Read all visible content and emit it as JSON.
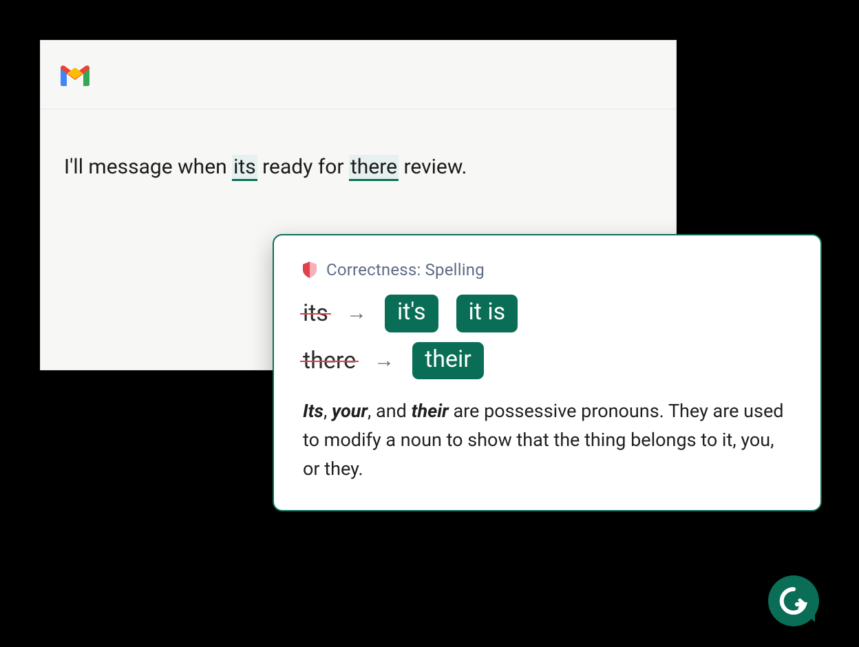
{
  "compose": {
    "sentence_parts": {
      "p0": "I'll message when ",
      "hl0": "its",
      "p1": " ready for ",
      "hl1": "there",
      "p2": " review."
    }
  },
  "card": {
    "category": "Correctness: Spelling",
    "rows": [
      {
        "original": "its",
        "suggestions": [
          "it's",
          "it is"
        ]
      },
      {
        "original": "there",
        "suggestions": [
          "their"
        ]
      }
    ],
    "explain": {
      "b0": "Its",
      "t0": ", ",
      "b1": "your",
      "t1": ", and ",
      "b2": "their",
      "t2": " are possessive pronouns. They are used to modify a noun to show that the thing belongs to it, you, or they."
    }
  }
}
